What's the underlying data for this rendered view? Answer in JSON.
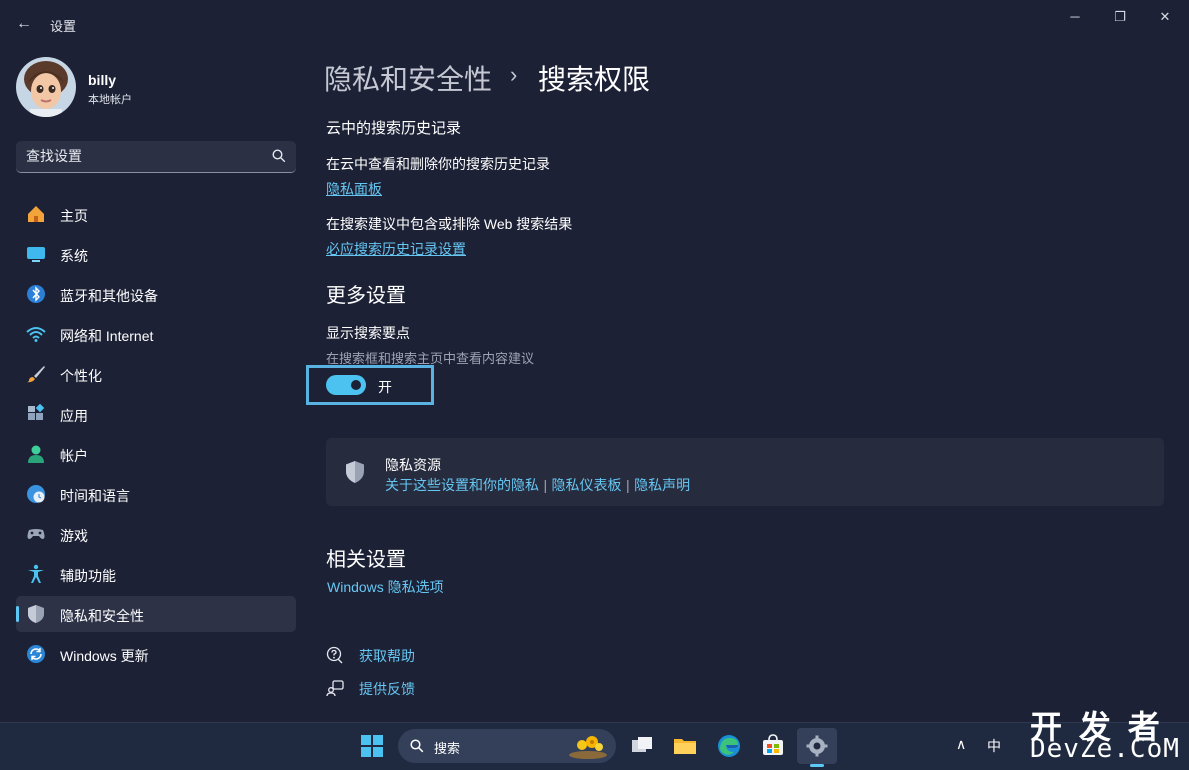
{
  "window": {
    "title": "设置",
    "back_glyph": "←",
    "minimize_glyph": "─",
    "maximize_glyph": "❐",
    "close_glyph": "✕"
  },
  "profile": {
    "name": "billy",
    "account_type": "本地帐户"
  },
  "search": {
    "placeholder": "查找设置"
  },
  "sidebar": {
    "items": [
      {
        "label": "主页",
        "icon": "home-icon",
        "active": false
      },
      {
        "label": "系统",
        "icon": "system-icon",
        "active": false
      },
      {
        "label": "蓝牙和其他设备",
        "icon": "bluetooth-icon",
        "active": false
      },
      {
        "label": "网络和 Internet",
        "icon": "wifi-icon",
        "active": false
      },
      {
        "label": "个性化",
        "icon": "brush-icon",
        "active": false
      },
      {
        "label": "应用",
        "icon": "apps-icon",
        "active": false
      },
      {
        "label": "帐户",
        "icon": "person-icon",
        "active": false
      },
      {
        "label": "时间和语言",
        "icon": "clock-globe-icon",
        "active": false
      },
      {
        "label": "游戏",
        "icon": "gamepad-icon",
        "active": false
      },
      {
        "label": "辅助功能",
        "icon": "accessibility-icon",
        "active": false
      },
      {
        "label": "隐私和安全性",
        "icon": "shield-icon",
        "active": true
      },
      {
        "label": "Windows 更新",
        "icon": "update-icon",
        "active": false
      }
    ]
  },
  "breadcrumb": {
    "parent": "隐私和安全性",
    "separator": "›",
    "current": "搜索权限"
  },
  "cloud_history": {
    "heading": "云中的搜索历史记录",
    "view_delete_text": "在云中查看和删除你的搜索历史记录",
    "privacy_dashboard_link": "隐私面板",
    "include_exclude_text": "在搜索建议中包含或排除 Web 搜索结果",
    "bing_settings_link": "必应搜索历史记录设置"
  },
  "more_settings": {
    "heading": "更多设置",
    "highlights_label": "显示搜索要点",
    "highlights_desc": "在搜索框和搜索主页中查看内容建议",
    "toggle_state_label": "开",
    "toggle_on": true
  },
  "privacy_resources": {
    "title": "隐私资源",
    "links": [
      "关于这些设置和你的隐私",
      "隐私仪表板",
      "隐私声明"
    ],
    "separator": "|"
  },
  "related": {
    "heading": "相关设置",
    "windows_privacy_link": "Windows 隐私选项"
  },
  "help": {
    "get_help": "获取帮助",
    "feedback": "提供反馈"
  },
  "taskbar": {
    "search_label": "搜索",
    "tray_chevron": "∧",
    "ime_label": "中"
  },
  "watermark": {
    "line1": "开 发 者",
    "line2": "DevZe.CoM"
  },
  "colors": {
    "accent": "#4cc2f1",
    "link": "#66c6f2",
    "background": "#1c2135",
    "card": "#262b3e"
  }
}
